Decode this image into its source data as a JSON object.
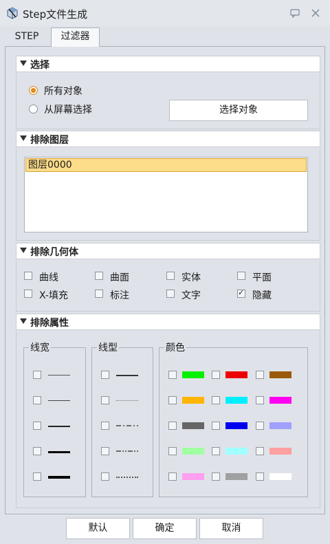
{
  "window": {
    "title": "Step文件生成"
  },
  "tabs": [
    {
      "label": "STEP",
      "active": false
    },
    {
      "label": "过滤器",
      "active": true
    }
  ],
  "select_group": {
    "title": "选择",
    "radios": [
      {
        "label": "所有对象",
        "checked": true
      },
      {
        "label": "从屏幕选择",
        "checked": false
      }
    ],
    "select_button": "选择对象"
  },
  "exclude_layers": {
    "title": "排除图层",
    "items": [
      "图层0000"
    ]
  },
  "exclude_geometry": {
    "title": "排除几何体",
    "items": [
      {
        "label": "曲线",
        "checked": false
      },
      {
        "label": "曲面",
        "checked": false
      },
      {
        "label": "实体",
        "checked": false
      },
      {
        "label": "平面",
        "checked": false
      },
      {
        "label": "X-填充",
        "checked": false
      },
      {
        "label": "标注",
        "checked": false
      },
      {
        "label": "文字",
        "checked": false
      },
      {
        "label": "隐藏",
        "checked": true
      }
    ]
  },
  "exclude_attributes": {
    "title": "排除属性",
    "line_width_title": "线宽",
    "line_width": [
      1,
      1.5,
      2,
      3,
      4
    ],
    "line_type_title": "线型",
    "line_type": [
      "solid",
      "dotted",
      "dash-dot",
      "dash-dot-dot",
      "dashed"
    ],
    "color_title": "颜色",
    "colors": [
      [
        "#00f000",
        "#ee0000",
        "#9a5a0e"
      ],
      [
        "#ffb400",
        "#00f0ff",
        "#ff00f0"
      ],
      [
        "#666666",
        "#0000ee",
        "#a0a0ff"
      ],
      [
        "#a0ffa0",
        "#a0ffff",
        "#ffa0a0"
      ],
      [
        "#ff9ff0",
        "#a0a0a0",
        "#ffffff"
      ]
    ]
  },
  "footer": {
    "default_label": "默认",
    "ok_label": "确定",
    "cancel_label": "取消"
  },
  "icons": {
    "app": "step-app-icon",
    "help": "help-icon",
    "close": "close-icon",
    "collapse": "triangle-down-icon"
  }
}
